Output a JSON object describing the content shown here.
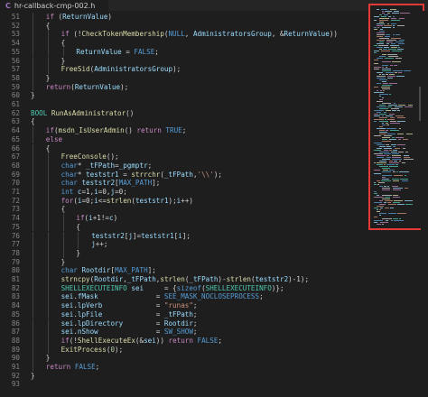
{
  "tab": {
    "icon": "C",
    "title": "hr-callback-cmp-002.h"
  },
  "lines": [
    {
      "n": "51",
      "indent": 1,
      "tokens": [
        [
          "ctl",
          "if"
        ],
        [
          "plain",
          " ("
        ],
        [
          "var",
          "ReturnValue"
        ],
        [
          "plain",
          ")"
        ]
      ]
    },
    {
      "n": "52",
      "indent": 1,
      "tokens": [
        [
          "plain",
          "{"
        ]
      ]
    },
    {
      "n": "53",
      "indent": 2,
      "tokens": [
        [
          "ctl",
          "if"
        ],
        [
          "plain",
          " (!"
        ],
        [
          "fn",
          "CheckTokenMembership"
        ],
        [
          "plain",
          "("
        ],
        [
          "mac",
          "NULL"
        ],
        [
          "plain",
          ", "
        ],
        [
          "var",
          "AdministratorsGroup"
        ],
        [
          "plain",
          ", &"
        ],
        [
          "var",
          "ReturnValue"
        ],
        [
          "plain",
          "))"
        ]
      ]
    },
    {
      "n": "54",
      "indent": 2,
      "tokens": [
        [
          "plain",
          "{"
        ]
      ]
    },
    {
      "n": "55",
      "indent": 3,
      "tokens": [
        [
          "var",
          "ReturnValue"
        ],
        [
          "plain",
          " = "
        ],
        [
          "mac",
          "FALSE"
        ],
        [
          "plain",
          ";"
        ]
      ]
    },
    {
      "n": "56",
      "indent": 2,
      "tokens": [
        [
          "plain",
          "}"
        ]
      ]
    },
    {
      "n": "57",
      "indent": 2,
      "tokens": [
        [
          "fn",
          "FreeSid"
        ],
        [
          "plain",
          "("
        ],
        [
          "var",
          "AdministratorsGroup"
        ],
        [
          "plain",
          ");"
        ]
      ]
    },
    {
      "n": "58",
      "indent": 1,
      "tokens": [
        [
          "plain",
          "}"
        ]
      ]
    },
    {
      "n": "59",
      "indent": 1,
      "tokens": [
        [
          "ctl",
          "return"
        ],
        [
          "plain",
          "("
        ],
        [
          "var",
          "ReturnValue"
        ],
        [
          "plain",
          ");"
        ]
      ]
    },
    {
      "n": "60",
      "indent": 0,
      "tokens": [
        [
          "plain",
          "}"
        ]
      ]
    },
    {
      "n": "61",
      "indent": 0,
      "tokens": []
    },
    {
      "n": "62",
      "indent": 0,
      "tokens": [
        [
          "ty",
          "BOOL"
        ],
        [
          "plain",
          " "
        ],
        [
          "fn",
          "RunAsAdministrator"
        ],
        [
          "plain",
          "()"
        ]
      ]
    },
    {
      "n": "63",
      "indent": 0,
      "tokens": [
        [
          "plain",
          "{"
        ]
      ]
    },
    {
      "n": "64",
      "indent": 1,
      "tokens": [
        [
          "ctl",
          "if"
        ],
        [
          "plain",
          "("
        ],
        [
          "fn",
          "msdn_IsUserAdmin"
        ],
        [
          "plain",
          "() "
        ],
        [
          "ctl",
          "return"
        ],
        [
          "plain",
          " "
        ],
        [
          "mac",
          "TRUE"
        ],
        [
          "plain",
          ";"
        ]
      ]
    },
    {
      "n": "65",
      "indent": 1,
      "tokens": [
        [
          "ctl",
          "else"
        ]
      ]
    },
    {
      "n": "66",
      "indent": 1,
      "tokens": [
        [
          "plain",
          "{"
        ]
      ]
    },
    {
      "n": "67",
      "indent": 2,
      "tokens": [
        [
          "fn",
          "FreeConsole"
        ],
        [
          "plain",
          "();"
        ]
      ]
    },
    {
      "n": "68",
      "indent": 2,
      "tokens": [
        [
          "kw",
          "char"
        ],
        [
          "plain",
          "* "
        ],
        [
          "var",
          "_tFPath"
        ],
        [
          "plain",
          "="
        ],
        [
          "var",
          "_pgmptr"
        ],
        [
          "plain",
          ";"
        ]
      ]
    },
    {
      "n": "69",
      "indent": 2,
      "tokens": [
        [
          "kw",
          "char"
        ],
        [
          "plain",
          "* "
        ],
        [
          "var",
          "teststr1"
        ],
        [
          "plain",
          " = "
        ],
        [
          "fn",
          "strrchr"
        ],
        [
          "plain",
          "("
        ],
        [
          "var",
          "_tFPath"
        ],
        [
          "plain",
          ","
        ],
        [
          "str",
          "'\\\\'"
        ],
        [
          "plain",
          ");"
        ]
      ]
    },
    {
      "n": "70",
      "indent": 2,
      "tokens": [
        [
          "kw",
          "char"
        ],
        [
          "plain",
          " "
        ],
        [
          "var",
          "teststr2"
        ],
        [
          "plain",
          "["
        ],
        [
          "mac",
          "MAX_PATH"
        ],
        [
          "plain",
          "];"
        ]
      ]
    },
    {
      "n": "71",
      "indent": 2,
      "tokens": [
        [
          "kw",
          "int"
        ],
        [
          "plain",
          " "
        ],
        [
          "var",
          "c"
        ],
        [
          "plain",
          "=1,"
        ],
        [
          "var",
          "i"
        ],
        [
          "plain",
          "=0,"
        ],
        [
          "var",
          "j"
        ],
        [
          "plain",
          "=0;"
        ]
      ]
    },
    {
      "n": "72",
      "indent": 2,
      "tokens": [
        [
          "ctl",
          "for"
        ],
        [
          "plain",
          "("
        ],
        [
          "var",
          "i"
        ],
        [
          "plain",
          "=0;"
        ],
        [
          "var",
          "i"
        ],
        [
          "plain",
          "<="
        ],
        [
          "fn",
          "strlen"
        ],
        [
          "plain",
          "("
        ],
        [
          "var",
          "teststr1"
        ],
        [
          "plain",
          ");"
        ],
        [
          "var",
          "i"
        ],
        [
          "plain",
          "++)"
        ]
      ]
    },
    {
      "n": "73",
      "indent": 2,
      "tokens": [
        [
          "plain",
          "{"
        ]
      ]
    },
    {
      "n": "74",
      "indent": 3,
      "tokens": [
        [
          "ctl",
          "if"
        ],
        [
          "plain",
          "("
        ],
        [
          "var",
          "i"
        ],
        [
          "plain",
          "+1!="
        ],
        [
          "var",
          "c"
        ],
        [
          "plain",
          ")"
        ]
      ]
    },
    {
      "n": "75",
      "indent": 3,
      "tokens": [
        [
          "plain",
          "{"
        ]
      ]
    },
    {
      "n": "76",
      "indent": 4,
      "tokens": [
        [
          "var",
          "teststr2"
        ],
        [
          "plain",
          "["
        ],
        [
          "var",
          "j"
        ],
        [
          "plain",
          "]="
        ],
        [
          "var",
          "teststr1"
        ],
        [
          "plain",
          "["
        ],
        [
          "var",
          "i"
        ],
        [
          "plain",
          "];"
        ]
      ]
    },
    {
      "n": "77",
      "indent": 4,
      "tokens": [
        [
          "var",
          "j"
        ],
        [
          "plain",
          "++;"
        ]
      ]
    },
    {
      "n": "78",
      "indent": 3,
      "tokens": [
        [
          "plain",
          "}"
        ]
      ]
    },
    {
      "n": "79",
      "indent": 2,
      "tokens": [
        [
          "plain",
          "}"
        ]
      ]
    },
    {
      "n": "80",
      "indent": 2,
      "tokens": [
        [
          "kw",
          "char"
        ],
        [
          "plain",
          " "
        ],
        [
          "var",
          "Rootdir"
        ],
        [
          "plain",
          "["
        ],
        [
          "mac",
          "MAX_PATH"
        ],
        [
          "plain",
          "];"
        ]
      ]
    },
    {
      "n": "81",
      "indent": 2,
      "tokens": [
        [
          "fn",
          "strncpy"
        ],
        [
          "plain",
          "("
        ],
        [
          "var",
          "Rootdir"
        ],
        [
          "plain",
          ","
        ],
        [
          "var",
          "_tFPath"
        ],
        [
          "plain",
          ","
        ],
        [
          "fn",
          "strlen"
        ],
        [
          "plain",
          "("
        ],
        [
          "var",
          "_tFPath"
        ],
        [
          "plain",
          ")-"
        ],
        [
          "fn",
          "strlen"
        ],
        [
          "plain",
          "("
        ],
        [
          "var",
          "teststr2"
        ],
        [
          "plain",
          ")-1);"
        ]
      ]
    },
    {
      "n": "82",
      "indent": 2,
      "tokens": [
        [
          "ty",
          "SHELLEXECUTEINFO"
        ],
        [
          "plain",
          " "
        ],
        [
          "var",
          "sei"
        ],
        [
          "plain",
          "     = {"
        ],
        [
          "kw",
          "sizeof"
        ],
        [
          "plain",
          "("
        ],
        [
          "ty",
          "SHELLEXECUTEINFO"
        ],
        [
          "plain",
          ")};"
        ]
      ]
    },
    {
      "n": "83",
      "indent": 2,
      "tokens": [
        [
          "var",
          "sei"
        ],
        [
          "plain",
          "."
        ],
        [
          "var",
          "fMask"
        ],
        [
          "plain",
          "              = "
        ],
        [
          "mac",
          "SEE_MASK_NOCLOSEPROCESS"
        ],
        [
          "plain",
          ";"
        ]
      ]
    },
    {
      "n": "84",
      "indent": 2,
      "tokens": [
        [
          "var",
          "sei"
        ],
        [
          "plain",
          "."
        ],
        [
          "var",
          "lpVerb"
        ],
        [
          "plain",
          "             = "
        ],
        [
          "str",
          "\"runas\""
        ],
        [
          "plain",
          ";"
        ]
      ]
    },
    {
      "n": "85",
      "indent": 2,
      "tokens": [
        [
          "var",
          "sei"
        ],
        [
          "plain",
          "."
        ],
        [
          "var",
          "lpFile"
        ],
        [
          "plain",
          "             = "
        ],
        [
          "var",
          "_tFPath"
        ],
        [
          "plain",
          ";"
        ]
      ]
    },
    {
      "n": "86",
      "indent": 2,
      "tokens": [
        [
          "var",
          "sei"
        ],
        [
          "plain",
          "."
        ],
        [
          "var",
          "lpDirectory"
        ],
        [
          "plain",
          "        = "
        ],
        [
          "var",
          "Rootdir"
        ],
        [
          "plain",
          ";"
        ]
      ]
    },
    {
      "n": "87",
      "indent": 2,
      "tokens": [
        [
          "var",
          "sei"
        ],
        [
          "plain",
          "."
        ],
        [
          "var",
          "nShow"
        ],
        [
          "plain",
          "              = "
        ],
        [
          "mac",
          "SW_SHOW"
        ],
        [
          "plain",
          ";"
        ]
      ]
    },
    {
      "n": "88",
      "indent": 2,
      "tokens": [
        [
          "ctl",
          "if"
        ],
        [
          "plain",
          "(!"
        ],
        [
          "fn",
          "ShellExecuteEx"
        ],
        [
          "plain",
          "(&"
        ],
        [
          "var",
          "sei"
        ],
        [
          "plain",
          ")) "
        ],
        [
          "ctl",
          "return"
        ],
        [
          "plain",
          " "
        ],
        [
          "mac",
          "FALSE"
        ],
        [
          "plain",
          ";"
        ]
      ]
    },
    {
      "n": "89",
      "indent": 2,
      "tokens": [
        [
          "fn",
          "ExitProcess"
        ],
        [
          "plain",
          "("
        ],
        [
          "num",
          "0"
        ],
        [
          "plain",
          ");"
        ]
      ]
    },
    {
      "n": "90",
      "indent": 1,
      "tokens": [
        [
          "plain",
          "}"
        ]
      ]
    },
    {
      "n": "91",
      "indent": 1,
      "tokens": [
        [
          "ctl",
          "return"
        ],
        [
          "plain",
          " "
        ],
        [
          "mac",
          "FALSE"
        ],
        [
          "plain",
          ";"
        ]
      ]
    },
    {
      "n": "92",
      "indent": 0,
      "tokens": [
        [
          "plain",
          "}"
        ]
      ]
    },
    {
      "n": "93",
      "indent": 0,
      "tokens": []
    }
  ],
  "colors": {
    "keyword": "#569cd6",
    "control": "#c586c0",
    "function": "#dcdcaa",
    "type": "#4ec9b0",
    "variable": "#9cdcfe",
    "string": "#ce9178",
    "number": "#b5cea8",
    "minimap_highlight": "#e53935"
  }
}
